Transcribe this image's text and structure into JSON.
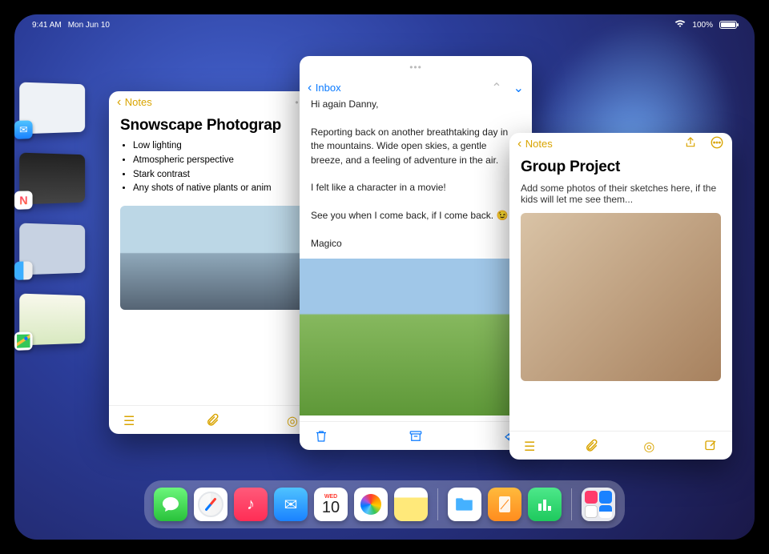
{
  "status": {
    "time": "9:41 AM",
    "date": "Mon Jun 10",
    "battery": "100%"
  },
  "calendar": {
    "weekday": "WED",
    "day": "10"
  },
  "notes_window": {
    "back_label": "Notes",
    "title": "Snowscape Photograp",
    "bullets": [
      "Low lighting",
      "Atmospheric perspective",
      "Stark contrast",
      "Any shots of native plants or anim"
    ]
  },
  "mail_window": {
    "back_label": "Inbox",
    "lines": [
      "Hi again Danny,",
      "",
      "Reporting back on another breathtaking day in the mountains. Wide open skies, a gentle breeze, and a feeling of adventure in the air.",
      "",
      "I felt like a character in a movie!",
      "",
      "See you when I come back, if I come back. 😉",
      "",
      "Magico"
    ]
  },
  "group_window": {
    "back_label": "Notes",
    "title": "Group Project",
    "body": "Add some photos of their sketches here, if the kids will let me see them..."
  }
}
